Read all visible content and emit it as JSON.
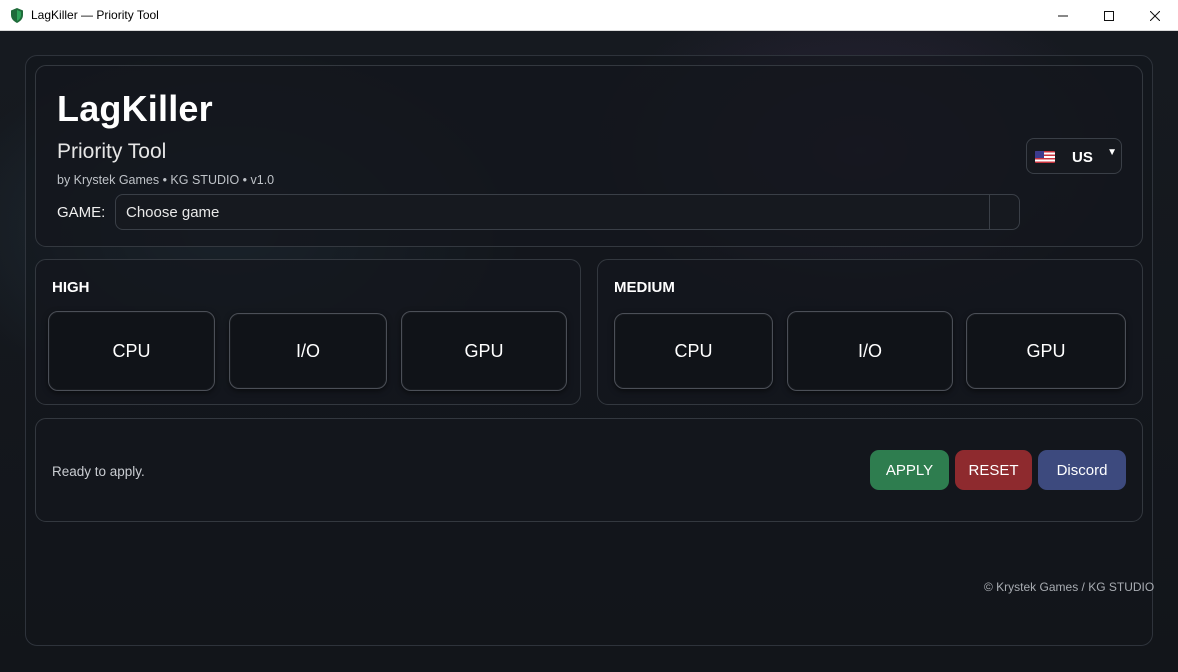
{
  "window": {
    "title": "LagKiller — Priority Tool",
    "minimize": "—",
    "maximize": "☐",
    "close": "✕"
  },
  "header": {
    "app_name": "LagKiller",
    "subtitle": "Priority Tool",
    "byline": "by Krystek Games • KG STUDIO • v1.0",
    "game_label": "GAME:",
    "game_select_value": "Choose game",
    "language_value": "US",
    "language_flag": "us-flag-icon"
  },
  "sections": {
    "high": {
      "title": "HIGH",
      "buttons": [
        "CPU",
        "I/O",
        "GPU"
      ]
    },
    "medium": {
      "title": "MEDIUM",
      "buttons": [
        "CPU",
        "I/O",
        "GPU"
      ]
    }
  },
  "status": {
    "message": "Ready to apply.",
    "apply_label": "APPLY",
    "reset_label": "RESET",
    "discord_label": "Discord"
  },
  "footer": {
    "copyright": "© Krystek Games / KG STUDIO"
  },
  "colors": {
    "apply": "#2e7d4f",
    "reset": "#8e2a2e",
    "discord": "#3d4a7e",
    "app_icon": "#1f6b3a"
  }
}
